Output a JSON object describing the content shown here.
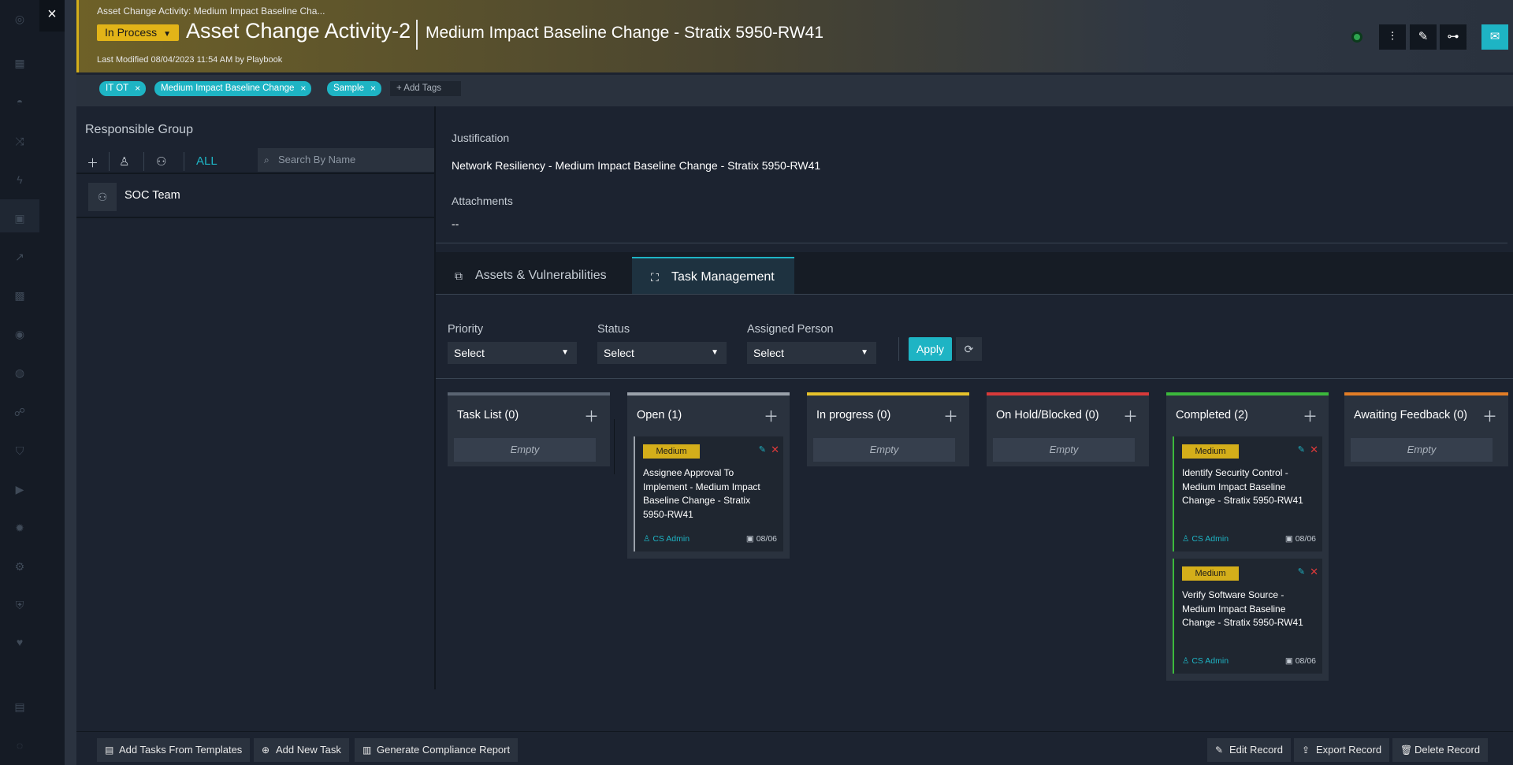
{
  "header": {
    "breadcrumb": "Asset Change Activity: Medium Impact Baseline Cha...",
    "status": "In Process",
    "title": "Asset Change Activity-2",
    "subtitle": "Medium Impact Baseline Change - Stratix 5950-RW41",
    "last_modified": "Last Modified 08/04/2023 11:54 AM by Playbook"
  },
  "tags": {
    "items": [
      "IT OT",
      "Medium Impact Baseline Change",
      "Sample"
    ],
    "add_label": "+ Add Tags"
  },
  "responsible_group": {
    "title": "Responsible Group",
    "filter_all": "ALL",
    "search_placeholder": "Search By Name",
    "members": [
      "SOC Team"
    ]
  },
  "details": {
    "justification_label": "Justification",
    "justification_value": "Network Resiliency - Medium Impact Baseline Change - Stratix 5950-RW41",
    "attachments_label": "Attachments",
    "attachments_value": "--"
  },
  "tabs": [
    "Assets & Vulnerabilities",
    "Task Management"
  ],
  "filters": {
    "priority_label": "Priority",
    "status_label": "Status",
    "assigned_label": "Assigned Person",
    "select_text": "Select",
    "apply_label": "Apply"
  },
  "board": {
    "empty_text": "Empty",
    "columns": [
      {
        "title": "Task List (0)",
        "color": "#5a6472"
      },
      {
        "title": "Open (1)",
        "color": "#9aa1aa"
      },
      {
        "title": "In progress (0)",
        "color": "#e6c22b"
      },
      {
        "title": "On Hold/Blocked (0)",
        "color": "#d83a3a"
      },
      {
        "title": "Completed (2)",
        "color": "#3cb83c"
      },
      {
        "title": "Awaiting Feedback (0)",
        "color": "#e27d26"
      }
    ],
    "cards": [
      {
        "priority": "Medium",
        "text": "Assignee Approval To Implement - Medium Impact Baseline Change - Stratix 5950-RW41",
        "owner": "CS Admin",
        "date": "08/06"
      },
      {
        "priority": "Medium",
        "text": "Identify Security Control - Medium Impact Baseline Change - Stratix 5950-RW41",
        "owner": "CS Admin",
        "date": "08/06"
      },
      {
        "priority": "Medium",
        "text": "Verify Software Source - Medium Impact Baseline Change - Stratix 5950-RW41",
        "owner": "CS Admin",
        "date": "08/06"
      }
    ]
  },
  "footer": {
    "add_templates": "Add Tasks From Templates",
    "add_task": "Add New Task",
    "compliance": "Generate Compliance Report",
    "edit": "Edit Record",
    "export": "Export Record",
    "delete": "Delete Record"
  }
}
